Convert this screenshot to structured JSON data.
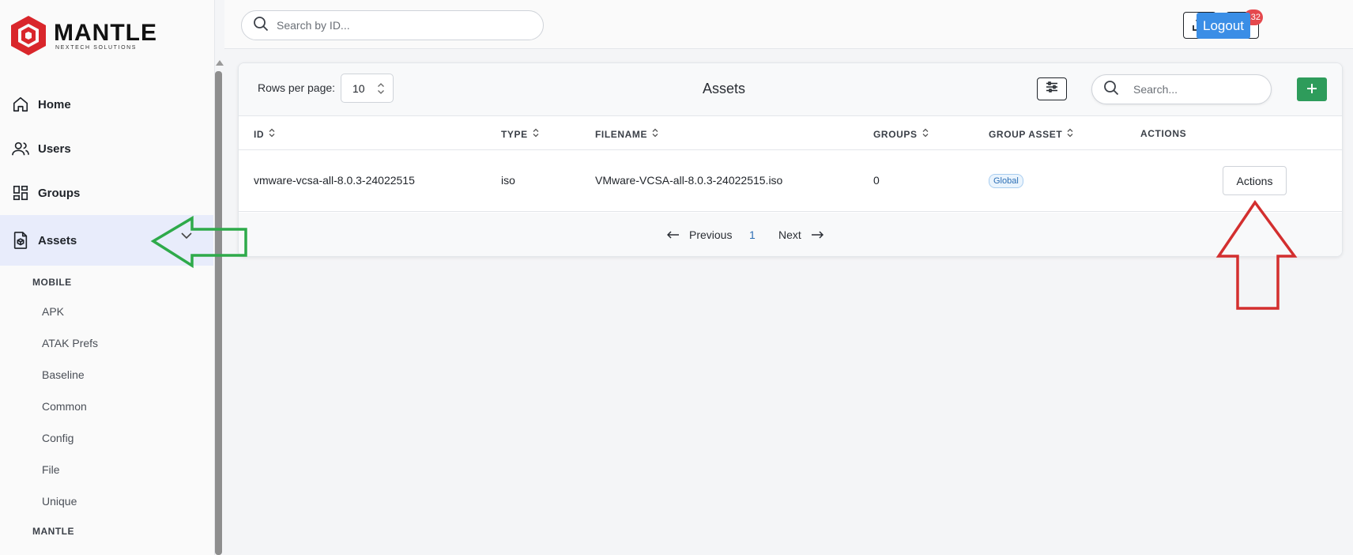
{
  "brand": {
    "name": "MANTLE",
    "tagline": "NEXTECH SOLUTIONS",
    "color": "#d9262b"
  },
  "sidebar": {
    "items": [
      {
        "label": "Home",
        "icon": "home-icon"
      },
      {
        "label": "Users",
        "icon": "users-icon"
      },
      {
        "label": "Groups",
        "icon": "grid-icon"
      },
      {
        "label": "Assets",
        "icon": "asset-file-icon",
        "active": true
      }
    ],
    "sections": [
      {
        "heading": "MOBILE",
        "items": [
          "APK",
          "ATAK Prefs",
          "Baseline",
          "Common",
          "Config",
          "File",
          "Unique"
        ]
      },
      {
        "heading": "MANTLE"
      }
    ]
  },
  "topbar": {
    "search_placeholder": "Search by ID...",
    "notification_count": "132",
    "logout_label": "Logout"
  },
  "card": {
    "rows_label": "Rows per page:",
    "rows_value": "10",
    "title": "Assets",
    "search_placeholder": "Search...",
    "columns": [
      "ID",
      "TYPE",
      "FILENAME",
      "GROUPS",
      "GROUP ASSET",
      "ACTIONS"
    ],
    "rows": [
      {
        "id": "vmware-vcsa-all-8.0.3-24022515",
        "type": "iso",
        "filename": "VMware-VCSA-all-8.0.3-24022515.iso",
        "groups": "0",
        "group_asset": "Global",
        "action_label": "Actions"
      }
    ],
    "pager": {
      "prev": "Previous",
      "page": "1",
      "next": "Next"
    }
  },
  "colors": {
    "accent_blue": "#3a8ee6",
    "add_green": "#2e9c5b",
    "badge_red": "#e5484d",
    "annotation_green": "#2eaa4a",
    "annotation_red": "#d32f2f"
  }
}
